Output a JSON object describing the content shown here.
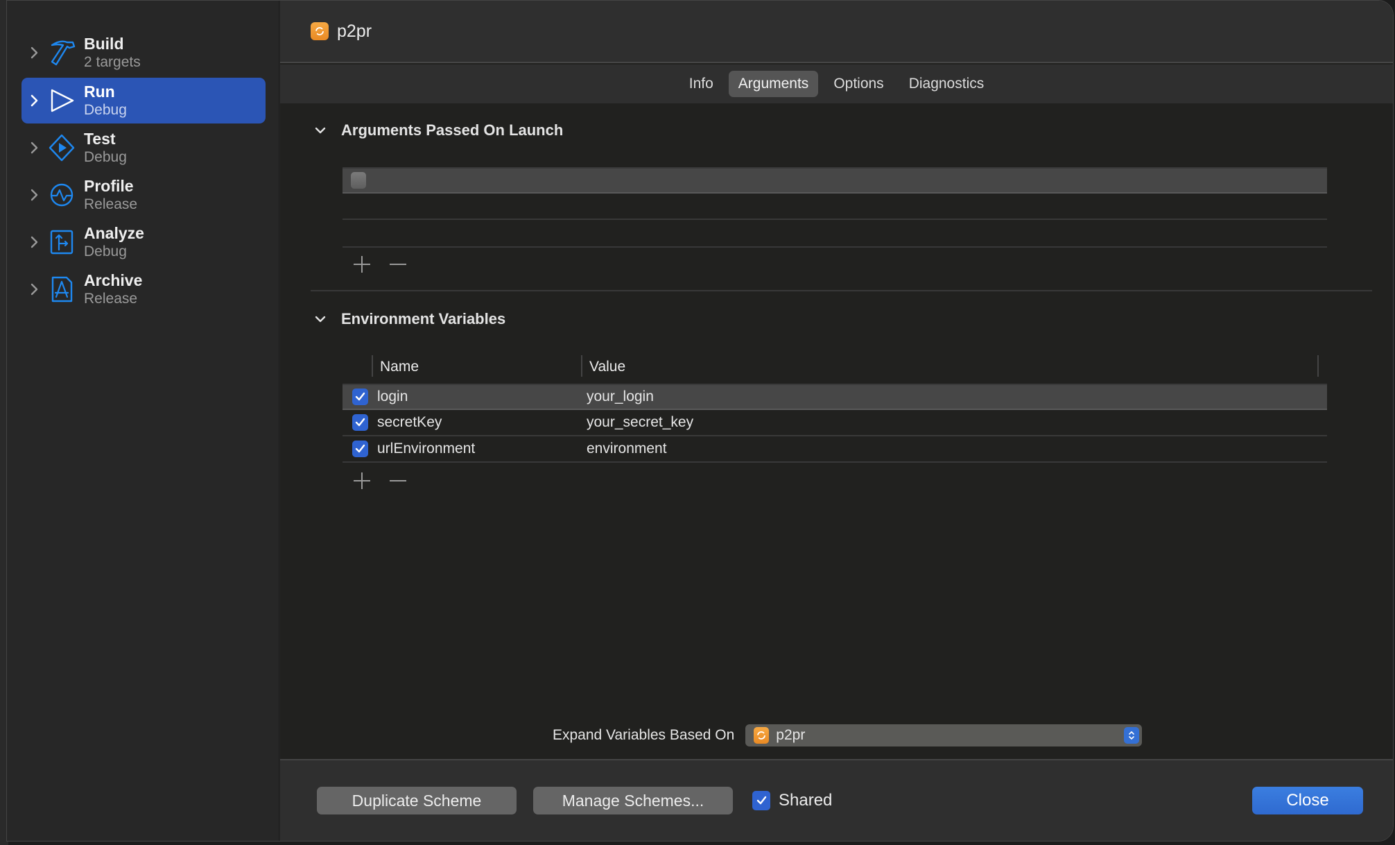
{
  "sidebar": {
    "items": [
      {
        "title": "Build",
        "subtitle": "2 targets",
        "icon": "hammer-icon",
        "selected": false
      },
      {
        "title": "Run",
        "subtitle": "Debug",
        "icon": "play-icon",
        "selected": true
      },
      {
        "title": "Test",
        "subtitle": "Debug",
        "icon": "test-diamond-icon",
        "selected": false
      },
      {
        "title": "Profile",
        "subtitle": "Release",
        "icon": "waveform-circle-icon",
        "selected": false
      },
      {
        "title": "Analyze",
        "subtitle": "Debug",
        "icon": "branch-square-icon",
        "selected": false
      },
      {
        "title": "Archive",
        "subtitle": "Release",
        "icon": "app-store-doc-icon",
        "selected": false
      }
    ]
  },
  "header": {
    "title": "p2pr",
    "icon": "scheme-target-icon",
    "icon_color": "#f09a33"
  },
  "tabs": [
    {
      "label": "Info",
      "active": false
    },
    {
      "label": "Arguments",
      "active": true
    },
    {
      "label": "Options",
      "active": false
    },
    {
      "label": "Diagnostics",
      "active": false
    }
  ],
  "arguments": {
    "title": "Arguments Passed On Launch",
    "rows": [
      {
        "checked": false,
        "value": ""
      }
    ]
  },
  "environment": {
    "title": "Environment Variables",
    "columns": {
      "name": "Name",
      "value": "Value"
    },
    "rows": [
      {
        "checked": true,
        "name": "login",
        "value": "your_login"
      },
      {
        "checked": true,
        "name": "secretKey",
        "value": "your_secret_key"
      },
      {
        "checked": true,
        "name": "urlEnvironment",
        "value": "environment"
      }
    ]
  },
  "expand": {
    "label": "Expand Variables Based On",
    "selected": "p2pr"
  },
  "footer": {
    "duplicate_label": "Duplicate Scheme",
    "manage_label": "Manage Schemes...",
    "shared_label": "Shared",
    "shared_checked": true,
    "close_label": "Close"
  },
  "colors": {
    "accent": "#2f63d1",
    "selection": "#2b55b5",
    "icon_blue": "#1e88f0"
  }
}
